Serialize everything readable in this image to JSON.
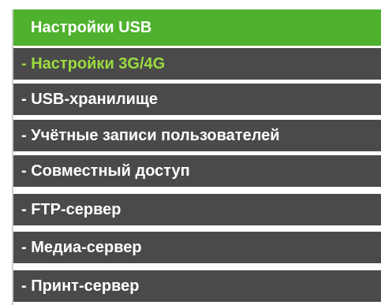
{
  "menu": {
    "header": "Настройки USB",
    "items": [
      {
        "label": "- Настройки 3G/4G",
        "active": true
      },
      {
        "label": "- USB-хранилище",
        "active": false
      },
      {
        "label": "- Учётные записи пользователей",
        "active": false
      },
      {
        "label": "- Совместный доступ",
        "active": false
      },
      {
        "label": "- FTP-сервер",
        "active": false
      },
      {
        "label": "- Медиа-сервер",
        "active": false
      },
      {
        "label": "- Принт-сервер",
        "active": false
      }
    ]
  },
  "colors": {
    "header_bg": "#4fb12d",
    "item_bg": "#4a4a4a",
    "active_text": "#9bdc3f",
    "text": "#ffffff"
  }
}
